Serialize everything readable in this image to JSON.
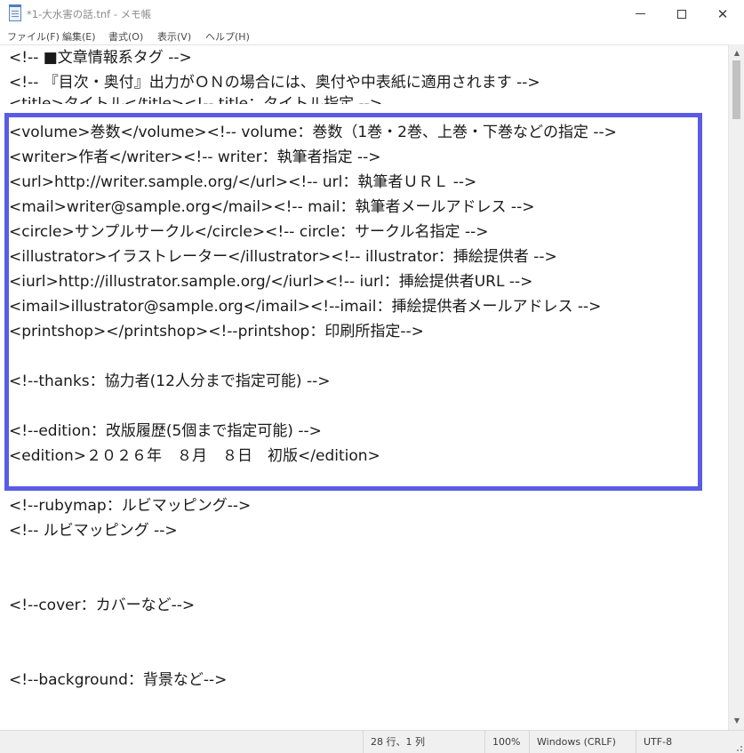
{
  "window": {
    "title": "*1-大水害の話.tnf - メモ帳",
    "minimize_symbol": "",
    "maximize_symbol": "",
    "close_symbol": "✕"
  },
  "menu": [
    "ファイル(F)",
    "編集(E)",
    "書式(O)",
    "表示(V)",
    "ヘルプ(H)"
  ],
  "editor": {
    "lines": [
      "<!-- ■文章情報系タグ -->",
      "<!-- 『目次・奥付』出力がＯＮの場合には、奥付や中表紙に適用されます -->",
      "<title>タイトル</title><!-- title：タイトル指定 -->",
      "<volume>巻数</volume><!-- volume：巻数（1巻・2巻、上巻・下巻などの指定 -->",
      "<writer>作者</writer><!-- writer：執筆者指定 -->",
      "<url>http://writer.sample.org/</url><!-- url：執筆者ＵＲＬ -->",
      "<mail>writer@sample.org</mail><!-- mail：執筆者メールアドレス -->",
      "<circle>サンプルサークル</circle><!-- circle：サークル名指定 -->",
      "<illustrator>イラストレーター</illustrator><!-- illustrator：挿絵提供者 -->",
      "<iurl>http://illustrator.sample.org/</iurl><!-- iurl：挿絵提供者URL -->",
      "<imail>illustrator@sample.org</imail><!--imail：挿絵提供者メールアドレス -->",
      "<printshop></printshop><!--printshop：印刷所指定-->",
      "",
      "<!--thanks：協力者(12人分まで指定可能) -->",
      "",
      "<!--edition：改版履歴(5個まで指定可能) -->",
      "<edition>２０２６年　８月　８日　初版</edition>",
      "<!--rubymap：ルビマッピング-->",
      "<!-- ルビマッピング -->",
      "",
      "",
      "<!--cover：カバーなど-->",
      "",
      "",
      "<!--background：背景など-->"
    ]
  },
  "scrollbar": {
    "up_arrow": "▲",
    "down_arrow": "▼"
  },
  "status": {
    "position": "28 行、1 列",
    "zoom": "100%",
    "line_ending": "Windows (CRLF)",
    "encoding": "UTF-8"
  },
  "colors": {
    "highlight_border": "#5a5ce6"
  }
}
